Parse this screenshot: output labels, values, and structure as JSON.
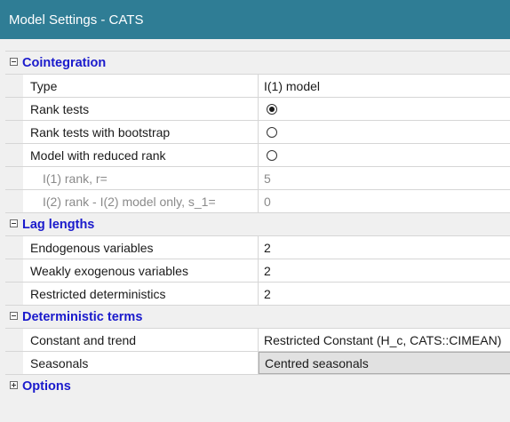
{
  "window": {
    "title": "Model Settings - CATS"
  },
  "sections": {
    "cointegration": {
      "label": "Cointegration",
      "expanded": true,
      "type": {
        "name": "Type",
        "value": "I(1) model"
      },
      "rank_tests": {
        "name": "Rank tests",
        "checked": true
      },
      "rank_tests_bootstrap": {
        "name": "Rank tests with bootstrap",
        "checked": false
      },
      "reduced_rank": {
        "name": "Model with reduced rank",
        "checked": false
      },
      "i1_rank": {
        "name": "I(1) rank, r=",
        "value": "5"
      },
      "i2_rank": {
        "name": "I(2) rank - I(2) model only, s_1=",
        "value": "0"
      }
    },
    "lag_lengths": {
      "label": "Lag lengths",
      "expanded": true,
      "endogenous": {
        "name": "Endogenous variables",
        "value": "2"
      },
      "weakly_exogenous": {
        "name": "Weakly exogenous variables",
        "value": "2"
      },
      "restricted_det": {
        "name": "Restricted deterministics",
        "value": "2"
      }
    },
    "deterministic": {
      "label": "Deterministic terms",
      "expanded": true,
      "constant_trend": {
        "name": "Constant and trend",
        "value": "Restricted Constant (H_c, CATS::CIMEAN)"
      },
      "seasonals": {
        "name": "Seasonals",
        "value": "Centred seasonals"
      }
    },
    "options": {
      "label": "Options",
      "expanded": false
    }
  }
}
